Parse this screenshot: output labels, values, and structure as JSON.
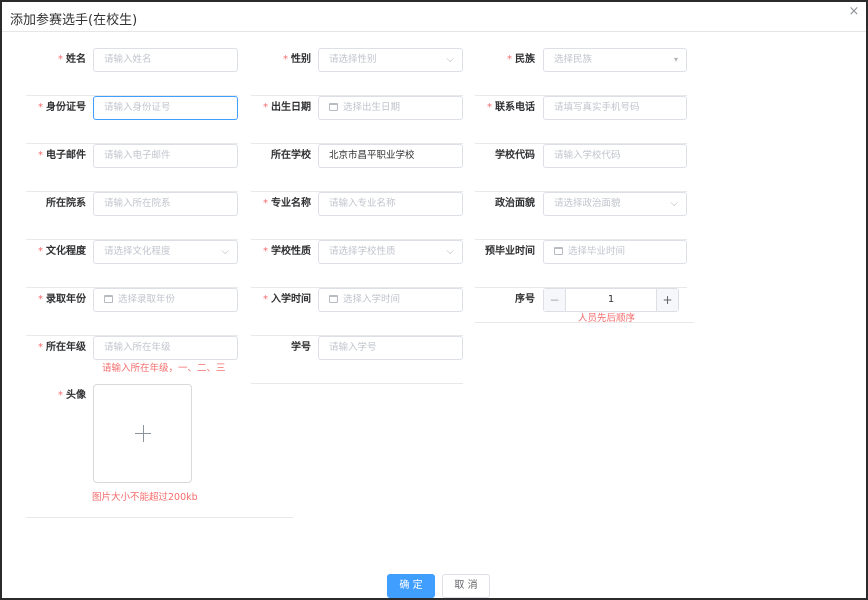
{
  "dialog": {
    "title": "添加参赛选手(在校生)",
    "close_glyph": "×"
  },
  "fields": {
    "name": {
      "label": "姓名",
      "placeholder": "请输入姓名"
    },
    "gender": {
      "label": "性别",
      "placeholder": "请选择性别"
    },
    "ethnicity": {
      "label": "民族",
      "placeholder": "选择民族"
    },
    "id_number": {
      "label": "身份证号",
      "placeholder": "请输入身份证号"
    },
    "birth_date": {
      "label": "出生日期",
      "placeholder": "选择出生日期"
    },
    "phone": {
      "label": "联系电话",
      "placeholder": "请填写真实手机号码"
    },
    "email": {
      "label": "电子邮件",
      "placeholder": "请输入电子邮件"
    },
    "school": {
      "label": "所在学校",
      "value": "北京市昌平职业学校"
    },
    "school_code": {
      "label": "学校代码",
      "placeholder": "请输入学校代码"
    },
    "department": {
      "label": "所在院系",
      "placeholder": "请输入所在院系"
    },
    "major": {
      "label": "专业名称",
      "placeholder": "请输入专业名称"
    },
    "political_status": {
      "label": "政治面貌",
      "placeholder": "请选择政治面貌"
    },
    "education": {
      "label": "文化程度",
      "placeholder": "请选择文化程度"
    },
    "school_type": {
      "label": "学校性质",
      "placeholder": "请选择学校性质"
    },
    "grad_time": {
      "label": "预毕业时间",
      "placeholder": "选择毕业时间"
    },
    "admission_year": {
      "label": "录取年份",
      "placeholder": "选择录取年份"
    },
    "enroll_time": {
      "label": "入学时间",
      "placeholder": "选择入学时间"
    },
    "order": {
      "label": "序号",
      "value": "1",
      "hint": "人员先后顺序",
      "dec": "−",
      "inc": "+"
    },
    "grade": {
      "label": "所在年级",
      "placeholder": "请输入所在年级",
      "hint": "请输入所在年级，一、二、三"
    },
    "student_id": {
      "label": "学号",
      "placeholder": "请输入学号"
    },
    "avatar": {
      "label": "头像",
      "hint": "图片大小不能超过200kb"
    }
  },
  "required_mark": "*",
  "chevron_glyph": "⌵",
  "footer": {
    "ok_label": "确 定",
    "cancel_label": "取 消"
  },
  "colors": {
    "primary": "#409eff",
    "danger": "#f56c6c",
    "border": "#dcdfe6"
  }
}
